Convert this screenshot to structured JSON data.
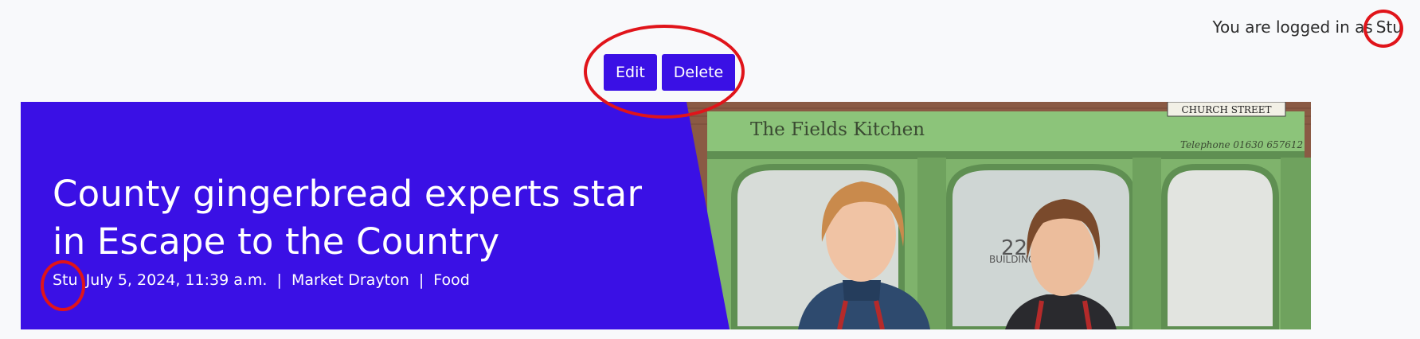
{
  "header": {
    "login_prefix": "You are logged in as",
    "username": "Stu"
  },
  "actions": {
    "edit_label": "Edit",
    "delete_label": "Delete"
  },
  "article": {
    "title": "County gingerbread experts star in Escape to the Country",
    "author": "Stu",
    "date": "July 5, 2024, 11:39 a.m.",
    "separator": "|",
    "location": "Market Drayton",
    "category": "Food"
  },
  "photo": {
    "shop_sign": "The Fields Kitchen",
    "street_sign": "CHURCH STREET",
    "telephone": "Telephone 01630 657612",
    "door_number": "22",
    "building_text": "BUILDINGS"
  },
  "colors": {
    "accent": "#3a10e5",
    "annotation": "#e0141a",
    "background": "#f8f9fb"
  }
}
